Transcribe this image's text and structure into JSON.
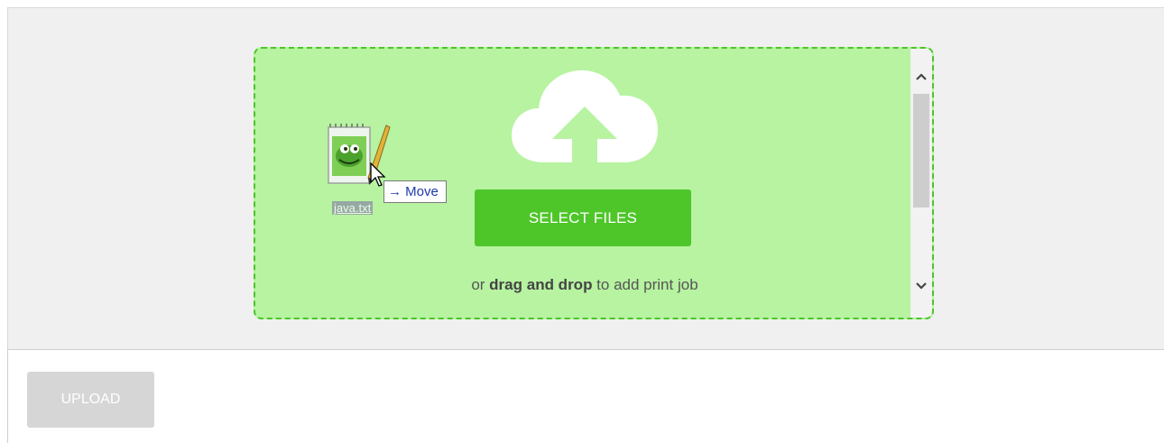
{
  "dropzone": {
    "select_button_label": "SELECT FILES",
    "hint_prefix": "or ",
    "hint_bold": "drag and drop",
    "hint_suffix": " to add print job",
    "background_color": "#b7f3a1",
    "border_color": "#4cc42a"
  },
  "drag": {
    "file_name": "java.txt",
    "tooltip_arrow": "→",
    "tooltip_label": "Move",
    "file_icon": "notepad-file-icon",
    "cursor_icon": "arrow-cursor-icon"
  },
  "footer": {
    "upload_label": "UPLOAD"
  },
  "icons": {
    "cloud": "cloud-upload-icon",
    "scroll_up": "chevron-up-icon",
    "scroll_down": "chevron-down-icon"
  },
  "colors": {
    "accent_button": "#4ec62a",
    "disabled_button": "#d6d6d6"
  }
}
